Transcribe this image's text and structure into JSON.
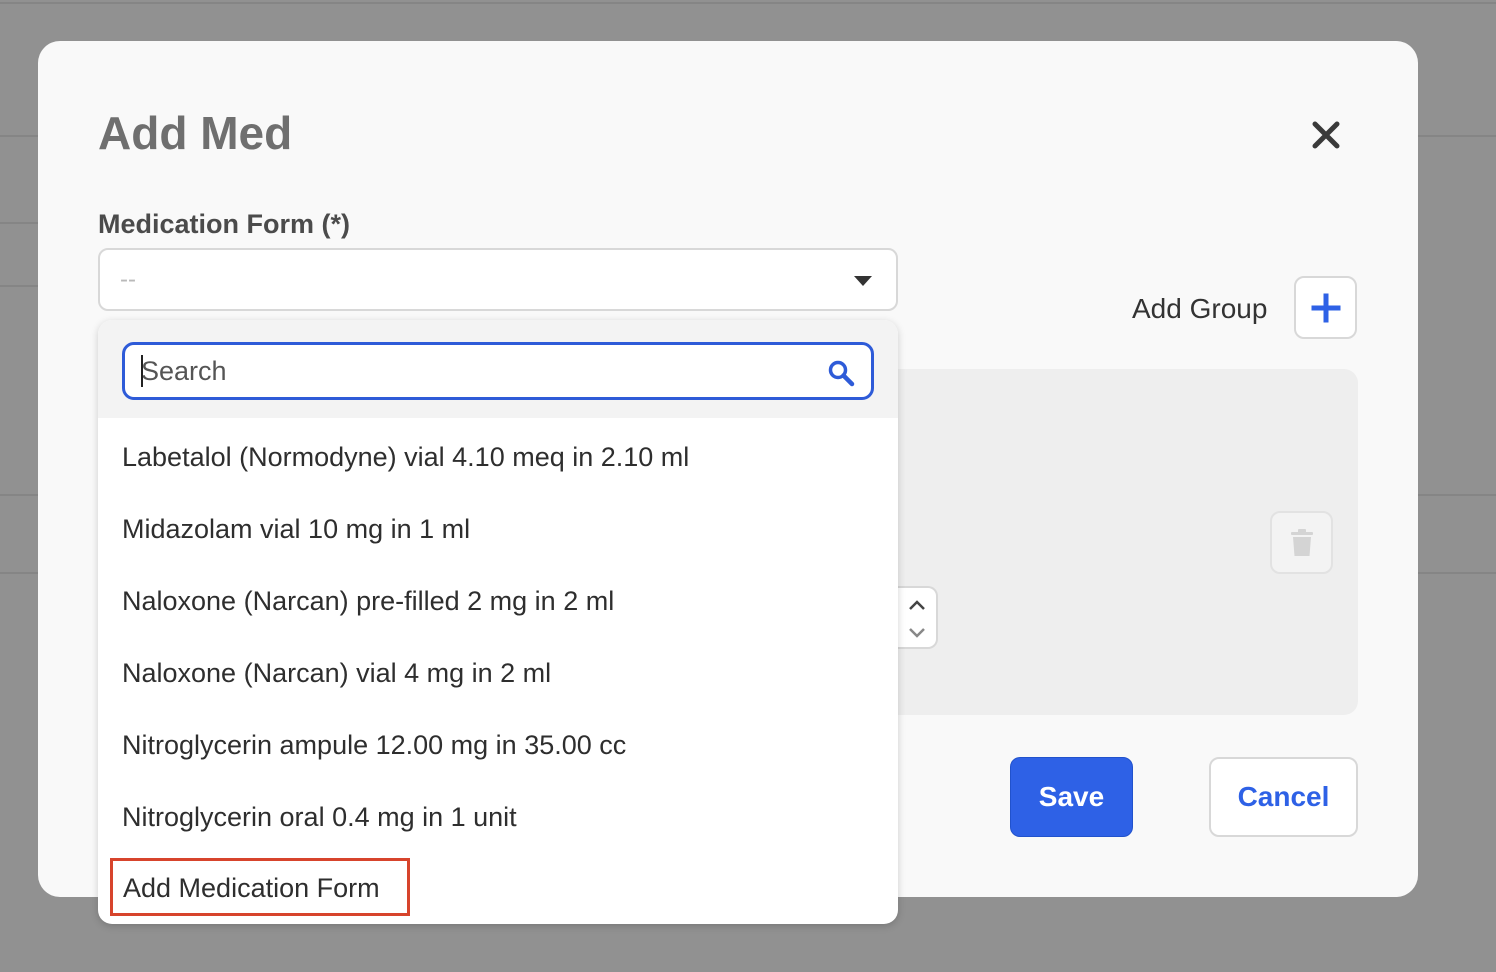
{
  "modal": {
    "title": "Add Med",
    "field_label": "Medication Form (*)",
    "select_value": "--",
    "add_group_label": "Add Group",
    "save_label": "Save",
    "cancel_label": "Cancel"
  },
  "dropdown": {
    "search_placeholder": "Search",
    "options": [
      "Labetalol (Normodyne) vial 4.10 meq in 2.10 ml",
      "Midazolam vial 10 mg in 1 ml",
      "Naloxone (Narcan) pre-filled 2 mg in 2 ml",
      "Naloxone (Narcan) vial 4 mg in 2 ml",
      "Nitroglycerin ampule 12.00 mg in 35.00 cc",
      "Nitroglycerin oral 0.4 mg in 1 unit"
    ],
    "add_option": "Add Medication Form"
  },
  "icons": {
    "close": "close-icon",
    "caret": "chevron-down-icon",
    "add": "plus-icon",
    "search": "search-icon",
    "trash": "trash-icon",
    "step_up": "chevron-up-icon",
    "step_down": "chevron-down-icon"
  },
  "colors": {
    "primary": "#2e61e6",
    "overlay": "#919191",
    "highlight_border": "#d7442c"
  }
}
